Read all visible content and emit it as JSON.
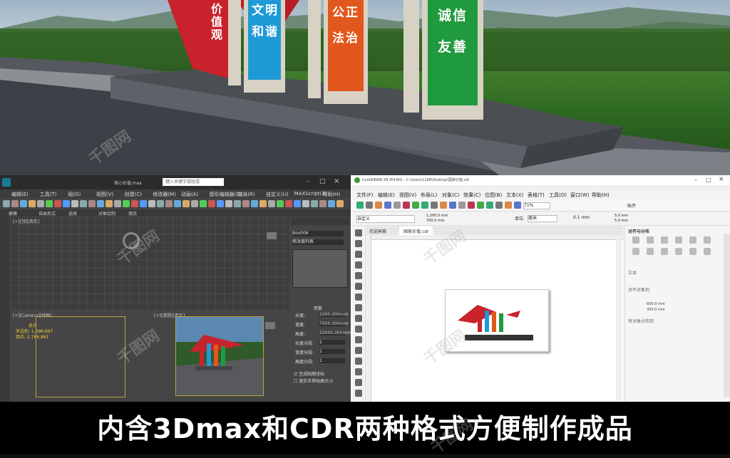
{
  "scene": {
    "panels": [
      {
        "text": "价值观",
        "color": "#c8232c"
      },
      {
        "text": "文明和谐",
        "color": "#1e9ad6"
      },
      {
        "text": "公正法治",
        "color": "#e2571c"
      },
      {
        "text": "诚信友善",
        "color": "#1f9a3c"
      }
    ]
  },
  "max_app": {
    "window_title": "核心价值.max",
    "search_placeholder": "键入关键字或短语",
    "menus": [
      "编辑(E)",
      "工具(T)",
      "组(G)",
      "视图(V)",
      "创建(C)",
      "修改器(M)",
      "动画(A)",
      "图形编辑器(D)",
      "渲染(R)",
      "自定义(U)",
      "MAXScript(X)",
      "帮助(H)"
    ],
    "ribbon_tabs": [
      "建模",
      "自由形式",
      "选择",
      "对象绘制",
      "填充"
    ],
    "viewport_labels": {
      "top": "[+][顶][真实]",
      "left": "[+][Camera][线框]",
      "right": "[+][透视][真实]"
    },
    "stats": {
      "total_label": "总计",
      "polys": "多边形: 1,696,667",
      "verts": "顶点: 2,766,861"
    },
    "params": {
      "title": "参数",
      "rows": [
        {
          "label": "长度:",
          "value": "1000.000mm"
        },
        {
          "label": "宽度:",
          "value": "7000.000mm"
        },
        {
          "label": "高度:",
          "value": "20000.000mm"
        },
        {
          "label": "长度分段:",
          "value": "1"
        },
        {
          "label": "宽度分段:",
          "value": "1"
        },
        {
          "label": "高度分段:",
          "value": "1"
        }
      ],
      "checks": [
        "生成贴图坐标",
        "真实世界贴图大小"
      ]
    },
    "modifier_list": "修改器列表",
    "object_name": "Box006"
  },
  "cdr_app": {
    "window_title": "CorelDRAW X8 (64-Bit) - C:\\Users\\1198\\Desktop\\国家价值.cdr",
    "menus": [
      "文件(F)",
      "编辑(E)",
      "视图(V)",
      "布局(L)",
      "对象(C)",
      "效果(C)",
      "位图(B)",
      "文本(X)",
      "表格(T)",
      "工具(O)",
      "窗口(W)",
      "帮助(H)"
    ],
    "preset": "自定义",
    "width": "1,200.0 mm",
    "height": "700.0 mm",
    "units_label": "单位:",
    "units": "毫米",
    "nudge": "0.1 mm",
    "dup_x": "5.0 mm",
    "dup_y": "5.0 mm",
    "snap": "贴齐",
    "zoom": "71%",
    "tabs": [
      "欢迎屏幕",
      "国家价值.cdr"
    ],
    "docker_title": "对齐与分布",
    "docker_sections": [
      "文本",
      "对齐对象到",
      "将对象分布到"
    ],
    "coord_x": "600.0 mm",
    "coord_y": "350.0 mm"
  },
  "caption": "内含3Dmax和CDR两种格式方便制作成品",
  "watermark": "千图网"
}
